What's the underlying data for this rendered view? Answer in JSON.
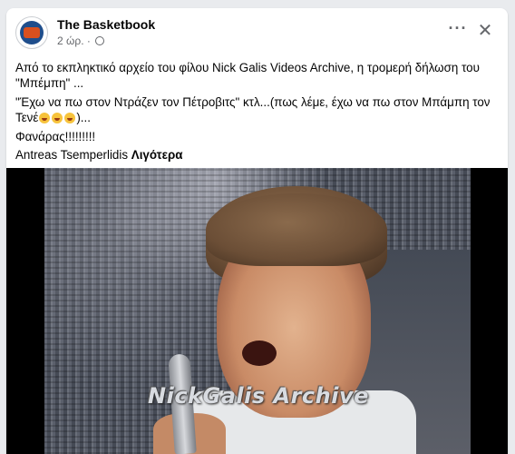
{
  "post": {
    "page_name": "The Basketbook",
    "time": "2 ώρ. ·",
    "text": {
      "line1": "Από το εκπληκτικό αρχείο του φίλου Nick Galis Videos Archive, η τρομερή δήλωση του \"Μπέμπη\" ...",
      "line2_start": "\"Έχω να πω στον Ντράζεν τον Πέτροβιτς\" κτλ...(πως λέμε, έχω να πω στον Μπάμπη τον Τενέ",
      "line2_end": ")...",
      "line3": "Φανάρας!!!!!!!!!",
      "line4": "Antreas Tsemperlidis",
      "see_more": "Λιγότερα"
    },
    "video": {
      "watermark": "NickGalis Archive"
    }
  },
  "icons": {
    "more": "more-horizontal-icon",
    "close": "close-icon",
    "globe": "globe-icon",
    "emoji": "laughing-emoji-icon"
  }
}
